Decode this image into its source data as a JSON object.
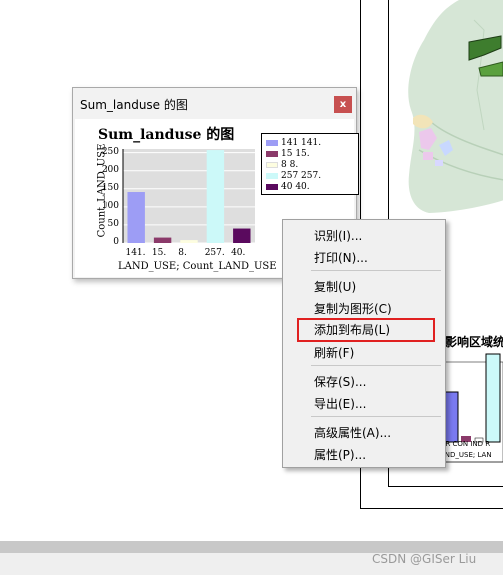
{
  "graph_window": {
    "title": "Sum_landuse 的图",
    "close_label": "x",
    "chart_heading": "Sum_landuse 的图",
    "ylabel": "Count_LAND_USE",
    "xlabel": "LAND_USE; Count_LAND_USE",
    "legend": [
      {
        "label": "141 141.",
        "color": "#9d9df5"
      },
      {
        "label": "15 15.",
        "color": "#8b3a6a"
      },
      {
        "label": "8 8.",
        "color": "#fdfde0"
      },
      {
        "label": "257 257.",
        "color": "#ccf9f9"
      },
      {
        "label": "40 40.",
        "color": "#5a0a5e"
      }
    ]
  },
  "chart_data": {
    "type": "bar",
    "categories": [
      "141.",
      "15.",
      "8.",
      "257.",
      "40."
    ],
    "values": [
      141,
      15,
      8,
      257,
      40
    ],
    "colors": [
      "#9d9df5",
      "#8b3a6a",
      "#fdfde0",
      "#ccf9f9",
      "#5a0a5e"
    ],
    "title": "Sum_landuse 的图",
    "xlabel": "LAND_USE; Count_LAND_USE",
    "ylabel": "Count_LAND_USE",
    "yticks": [
      0,
      50,
      100,
      150,
      200,
      250
    ],
    "ylim": [
      0,
      260
    ],
    "grid": true,
    "legend_position": "top-right"
  },
  "context_menu": {
    "items": [
      {
        "label": "识别(I)..."
      },
      {
        "label": "打印(N)..."
      },
      {
        "label": "复制(U)"
      },
      {
        "label": "复制为图形(C)"
      },
      {
        "label": "添加到布局(L)"
      },
      {
        "label": "刷新(F)"
      },
      {
        "label": "保存(S)..."
      },
      {
        "label": "导出(E)..."
      },
      {
        "label": "高级属性(A)..."
      },
      {
        "label": "属性(P)..."
      }
    ]
  },
  "background": {
    "embedded_chart_title": "影响区域统",
    "embedded_ticks": "GR CON IND R",
    "embedded_axis": "AND_USE; LAN"
  },
  "watermark": "CSDN @GISer Liu"
}
